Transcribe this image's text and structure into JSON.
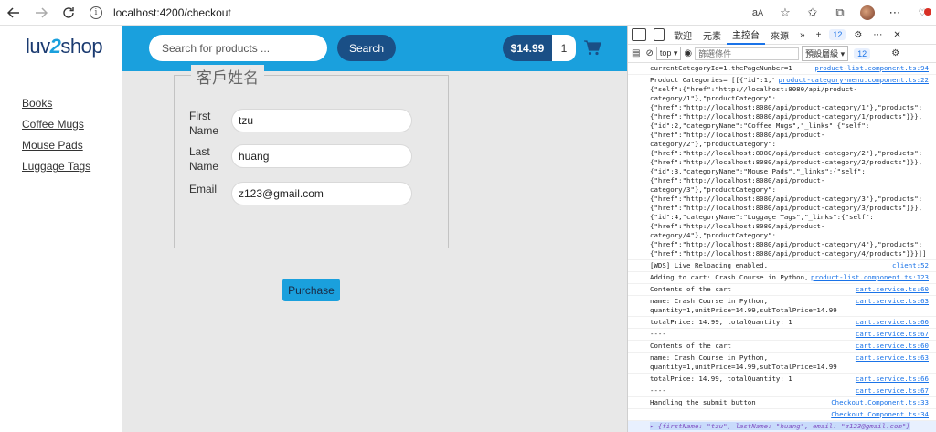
{
  "browser": {
    "url": "localhost:4200/checkout"
  },
  "logo": {
    "part1": "luv",
    "part2": "2",
    "part3": "shop"
  },
  "sidebar": {
    "items": [
      {
        "label": "Books"
      },
      {
        "label": "Coffee Mugs"
      },
      {
        "label": "Mouse Pads"
      },
      {
        "label": "Luggage Tags"
      }
    ]
  },
  "header": {
    "search_placeholder": "Search for products ...",
    "search_button": "Search",
    "cart_total": "$14.99",
    "cart_quantity": "1"
  },
  "form": {
    "legend": "客戶姓名",
    "fields": [
      {
        "label_line1": "First",
        "label_line2": "Name",
        "value": "tzu"
      },
      {
        "label_line1": "Last",
        "label_line2": "Name",
        "value": "huang"
      },
      {
        "label_line1": "Email",
        "label_line2": "",
        "value": "z123@gmail.com"
      }
    ],
    "purchase_button": "Purchase"
  },
  "devtools": {
    "tabs": [
      "歡迎",
      "元素",
      "主控台",
      "來源"
    ],
    "issues_count": "12",
    "context": "top",
    "filter_placeholder": "篩選條件",
    "levels": "預設層級",
    "toolbar_issues": "12",
    "console_lines": [
      {
        "text": "currentCategoryId=1,thePageNumber=1",
        "source": "product-list.component.ts:94"
      },
      {
        "text": "Product Categories= [[{\"id\":1,\"categoryName\":\"Books\",\"_links\":{\"self\":{\"href\":\"http://localhost:8080/api/product-category/1\"},\"productCategory\":{\"href\":\"http://localhost:8080/api/product-category/1\"},\"products\":{\"href\":\"http://localhost:8080/api/product-category/1/products\"}}}, {\"id\":2,\"categoryName\":\"Coffee Mugs\",\"_links\":{\"self\":{\"href\":\"http://localhost:8080/api/product-category/2\"},\"productCategory\":{\"href\":\"http://localhost:8080/api/product-category/2\"},\"products\":{\"href\":\"http://localhost:8080/api/product-category/2/products\"}}}, {\"id\":3,\"categoryName\":\"Mouse Pads\",\"_links\":{\"self\":{\"href\":\"http://localhost:8080/api/product-category/3\"},\"productCategory\":{\"href\":\"http://localhost:8080/api/product-category/3\"},\"products\":{\"href\":\"http://localhost:8080/api/product-category/3/products\"}}}, {\"id\":4,\"categoryName\":\"Luggage Tags\",\"_links\":{\"self\":{\"href\":\"http://localhost:8080/api/product-category/4\"},\"productCategory\":{\"href\":\"http://localhost:8080/api/product-category/4\"},\"products\":{\"href\":\"http://localhost:8080/api/product-category/4/products\"}}}]]",
        "source": "product-category-menu.component.ts:22"
      },
      {
        "text": "[WDS] Live Reloading enabled.",
        "source": "client:52"
      },
      {
        "text": "Adding to cart: Crash Course in Python,14.99",
        "source": "product-list.component.ts:123"
      },
      {
        "text": "Contents of the cart",
        "source": "cart.service.ts:60"
      },
      {
        "text": "name: Crash Course in Python, quantity=1,unitPrice=14.99,subTotalPrice=14.99",
        "source": "cart.service.ts:63"
      },
      {
        "text": "totalPrice: 14.99, totalQuantity: 1",
        "source": "cart.service.ts:66"
      },
      {
        "text": "----",
        "source": "cart.service.ts:67"
      },
      {
        "text": "Contents of the cart",
        "source": "cart.service.ts:60"
      },
      {
        "text": "name: Crash Course in Python, quantity=1,unitPrice=14.99,subTotalPrice=14.99",
        "source": "cart.service.ts:63"
      },
      {
        "text": "totalPrice: 14.99, totalQuantity: 1",
        "source": "cart.service.ts:66"
      },
      {
        "text": "----",
        "source": "cart.service.ts:67"
      },
      {
        "text": "Handling the submit button",
        "source": "Checkout.Component.ts:33"
      }
    ],
    "result_source": "Checkout.Component.ts:34",
    "result_object": "{firstName: \"tzu\", lastName: \"huang\", email: \"z123@gmail.com\"}"
  }
}
